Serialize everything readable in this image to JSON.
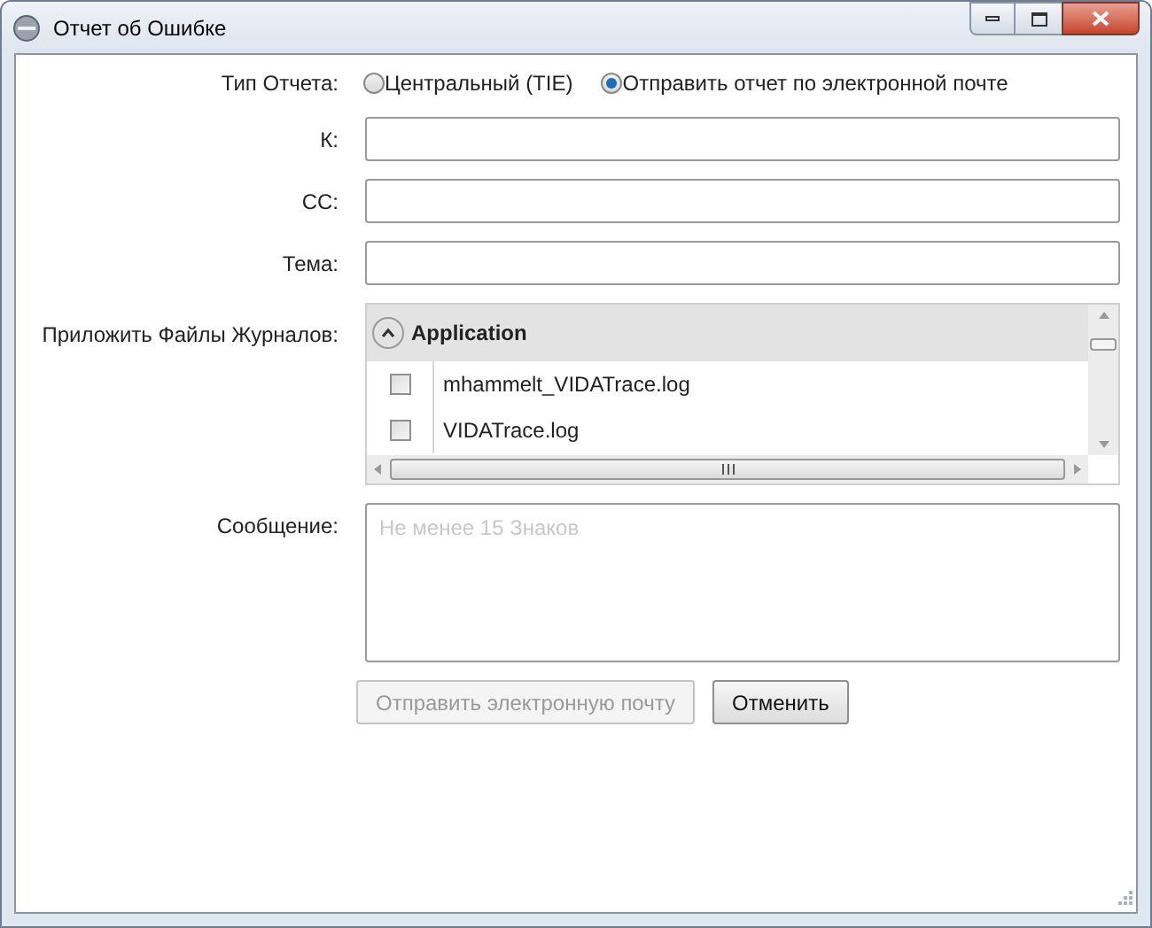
{
  "window": {
    "title": "Отчет об Ошибке"
  },
  "report_type": {
    "label": "Тип Отчета:",
    "options": [
      {
        "label": "Центральный (TIE)",
        "selected": false
      },
      {
        "label": "Отправить отчет по электронной почте",
        "selected": true
      }
    ]
  },
  "fields": [
    {
      "label": "К:"
    },
    {
      "label": "CC:"
    },
    {
      "label": "Тема:"
    }
  ],
  "log_files": {
    "label": "Приложить Файлы Журналов:",
    "group": {
      "title": "Application",
      "expanded": true
    },
    "files": [
      {
        "name": "mhammelt_VIDATrace.log",
        "checked": false
      },
      {
        "name": "VIDATrace.log",
        "checked": false
      }
    ]
  },
  "message": {
    "label": "Сообщение:",
    "placeholder": "Не менее 15 Знаков"
  },
  "buttons": [
    {
      "label": "Отправить электронную почту",
      "disabled": true
    },
    {
      "label": "Отменить",
      "disabled": false
    }
  ]
}
